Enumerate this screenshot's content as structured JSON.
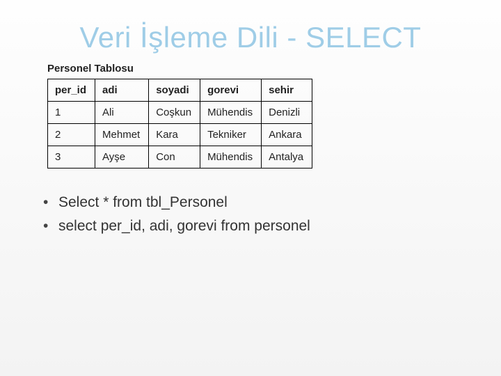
{
  "title": "Veri İşleme Dili - SELECT",
  "table_label": "Personel Tablosu",
  "table": {
    "headers": [
      "per_id",
      "adi",
      "soyadi",
      "gorevi",
      "sehir"
    ],
    "rows": [
      [
        "1",
        "Ali",
        "Coşkun",
        "Mühendis",
        "Denizli"
      ],
      [
        "2",
        "Mehmet",
        "Kara",
        "Tekniker",
        "Ankara"
      ],
      [
        "3",
        "Ayşe",
        "Con",
        "Mühendis",
        "Antalya"
      ]
    ]
  },
  "bullets": [
    "Select * from tbl_Personel",
    "select  per_id, adi, gorevi from personel"
  ]
}
